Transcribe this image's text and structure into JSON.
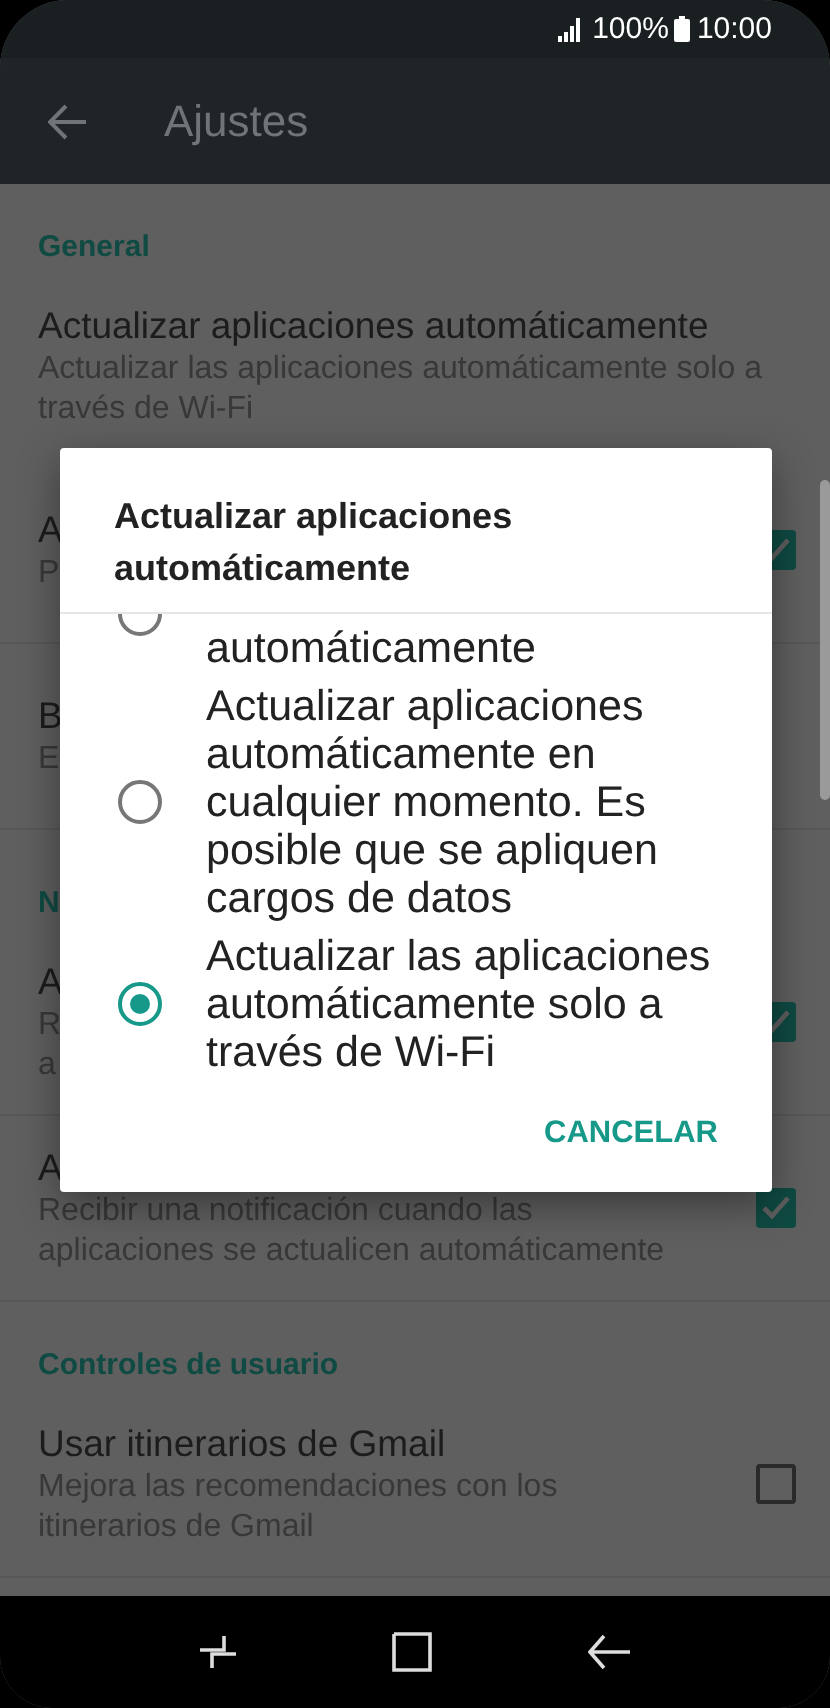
{
  "status_bar": {
    "battery": "100%",
    "time": "10:00"
  },
  "app_bar": {
    "title": "Ajustes"
  },
  "settings": [
    {
      "kind": "header",
      "title": "General"
    },
    {
      "kind": "item",
      "title": "Actualizar aplicaciones automáticamente",
      "summary": "Actualizar las aplicaciones automáticamente solo a través de Wi-Fi"
    },
    {
      "kind": "item",
      "title": "A",
      "summary": "P",
      "checked": true
    },
    {
      "kind": "item",
      "title": "B",
      "summary": "E"
    },
    {
      "kind": "header",
      "title": "N"
    },
    {
      "kind": "item",
      "title": "A",
      "summary": "R\na",
      "checked": true
    },
    {
      "kind": "item",
      "title": "A",
      "summary": "Recibir una notificación cuando las aplicaciones se actualicen automáticamente",
      "checked": true
    },
    {
      "kind": "header",
      "title": "Controles de usuario"
    },
    {
      "kind": "item",
      "title": "Usar itinerarios de Gmail",
      "summary": "Mejora las recomendaciones con los itinerarios de Gmail",
      "checked": false
    }
  ],
  "dialog": {
    "title": "Actualizar aplicaciones automáticamente",
    "options": [
      {
        "label": "automáticamente",
        "selected": false
      },
      {
        "label": "Actualizar aplicaciones automáticamente en cualquier momento. Es posible que se apliquen cargos de datos",
        "selected": false
      },
      {
        "label": "Actualizar las aplicaciones automáticamente solo a través de Wi-Fi",
        "selected": true
      }
    ],
    "button": "CANCELAR"
  }
}
